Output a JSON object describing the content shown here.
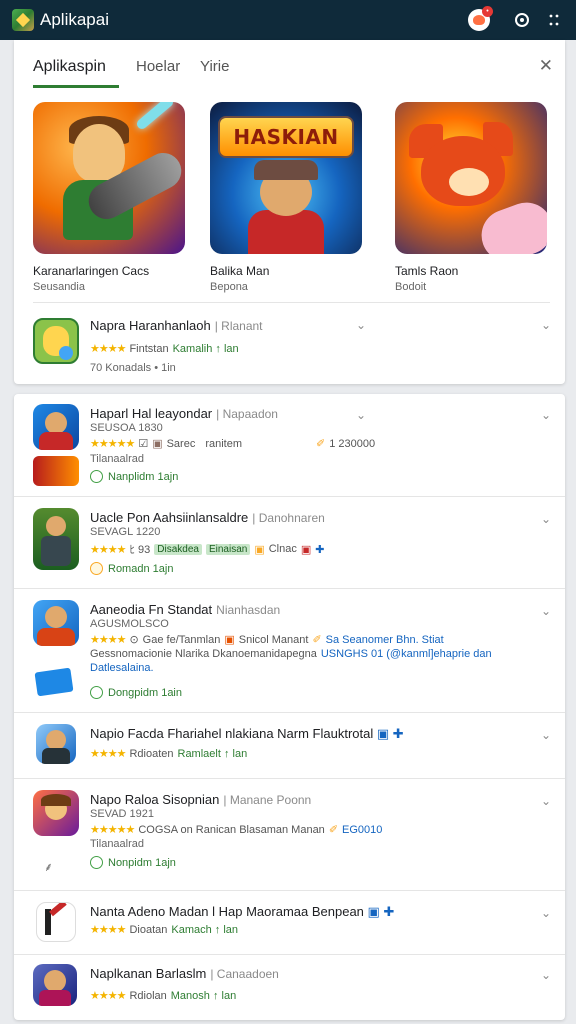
{
  "app": {
    "title": "Aplikapai"
  },
  "tabs": [
    {
      "label": "Aplikaspin"
    },
    {
      "label": "Hoelar"
    },
    {
      "label": "Yirie"
    }
  ],
  "featured": [
    {
      "name": "Karanarlaringen Cacs",
      "category": "Seusandia"
    },
    {
      "name": "Balika Man",
      "category": "Bepona",
      "banner": "HASKIAN"
    },
    {
      "name": "Tamls Raon",
      "category": "Bodoit"
    }
  ],
  "top_row": {
    "title": "Napra Haranhanlaoh",
    "sub": "| Rlanant",
    "rating_text": "Fintstan",
    "green_text": "Kamalih ↑ lan",
    "installs": "70 Konadals  •  1in"
  },
  "list": [
    {
      "title": "Haparl Hal leayondar",
      "sub": "| Napaadon",
      "code": "SEUSOA 1830",
      "rating_text": "Sarec",
      "extra": "ranitem",
      "right": "1 230000",
      "note": "Tilanaalrad",
      "status": "Nanplidm 1ajn"
    },
    {
      "title": "Uacle Pon Aahsiinlansaldre",
      "sub": "| Danohnaren",
      "code": "SEVAGL 1220",
      "tag1": "Disakdea",
      "tag2": "Einaisan",
      "extra": "Clnac",
      "status": "Romadn 1ajn"
    },
    {
      "title": "Aaneodia Fn Standat",
      "sub": "Nianhasdan",
      "code": "AGUSMOLSCO",
      "line1_a": "Gae fe/Tanmlan",
      "line1_b": "Snicol Manant",
      "line1_c": "Sa Seanomer Bhn. Stiat",
      "line2": "Gessnomacionie Nlarika Dkanoemanidapegna",
      "line2_b": "USNGHS 01 (@kanml]ehaprie dan",
      "line3": "Datlesalaina.",
      "status": "Dongpidm 1ain"
    },
    {
      "title": "Napio Facda Fhariahel nlakiana Narm Flauktrotal",
      "rating_text": "Rdioaten",
      "green_text": "Ramlaelt ↑ lan"
    },
    {
      "title": "Napo Raloa Sisopnian",
      "sub": "| Manane Poonn",
      "code": "SEVAD 1921",
      "line1_a": "COGSA on Ranican Blasaman Manan",
      "right": "EG0010",
      "note": "Tilanaalrad",
      "status": "Nonpidm 1ajn"
    },
    {
      "title": "Nanta Adeno Madan l Hap Maoramaa Benpean",
      "rating_text": "Dioatan",
      "green_text": "Kamach ↑ lan"
    },
    {
      "title": "Naplkanan Barlaslm",
      "sub": "| Canaadoen",
      "rating_text": "Rdiolan",
      "green_text": "Manosh ↑ lan"
    }
  ],
  "icons": {
    "close": "close-icon",
    "more": "more-vert-icon",
    "help": "help-icon"
  },
  "colors": {
    "appbar": "#0f2a3a",
    "accent": "#2e7d32",
    "star": "#f4b400"
  }
}
